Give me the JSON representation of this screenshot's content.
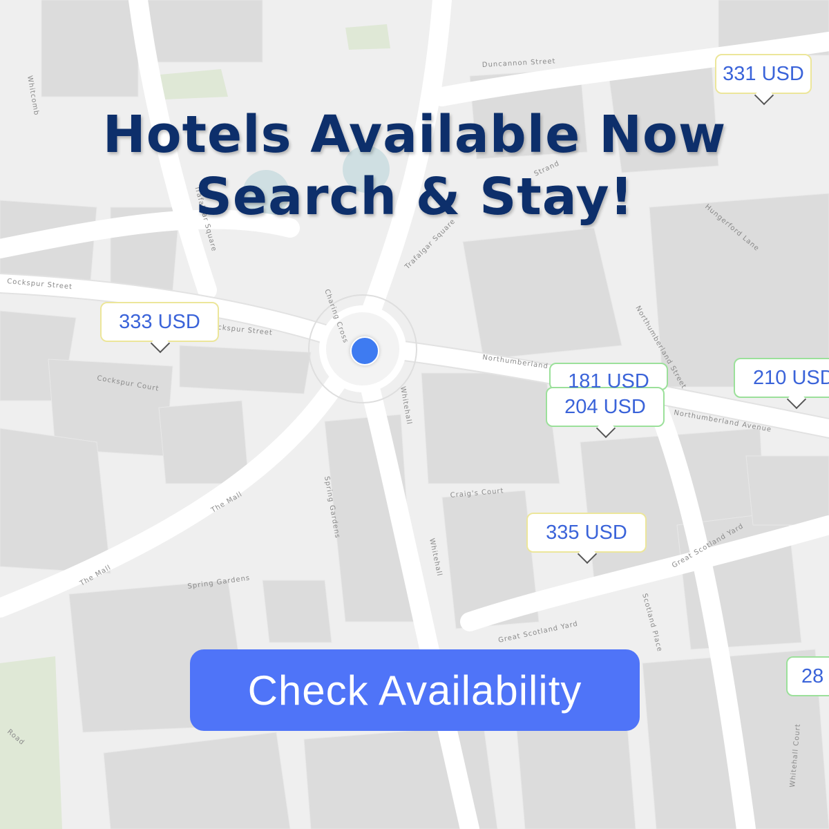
{
  "headline": {
    "line1": "Hotels Available Now",
    "line2": "Search & Stay!"
  },
  "streets": [
    "Duncannon Street",
    "Cockspur Street",
    "Cockspur Street",
    "Cockspur Court",
    "Charing Cross",
    "Whitehall",
    "Whitehall",
    "Northumberland Avenue",
    "Northumberland Avenue",
    "Northumberland Street",
    "Hungerford Lane",
    "Strand",
    "Trafalgar Square",
    "Trafalgar Square",
    "Craig's Court",
    "Spring Gardens",
    "Spring Gardens",
    "The Mall",
    "The Mall",
    "Great Scotland Yard",
    "Great Scotland Yard",
    "Scotland Place",
    "Whitcomb",
    "Road",
    "Whitehall Court"
  ],
  "price_pins": [
    {
      "label": "331 USD",
      "status": "yellow"
    },
    {
      "label": "333 USD",
      "status": "yellow"
    },
    {
      "label": "181 USD",
      "status": "green"
    },
    {
      "label": "204 USD",
      "status": "green"
    },
    {
      "label": "210 USD",
      "status": "green"
    },
    {
      "label": "335 USD",
      "status": "yellow"
    },
    {
      "label": "28",
      "status": "green"
    }
  ],
  "cta": {
    "label": "Check Availability"
  },
  "colors": {
    "headline": "#0d2f6b",
    "cta_bg": "#4f74f8",
    "pin_text": "#3a63d9",
    "pin_yellow_border": "#ece69a",
    "pin_green_border": "#9be09a",
    "location_dot": "#3e7bf1"
  }
}
